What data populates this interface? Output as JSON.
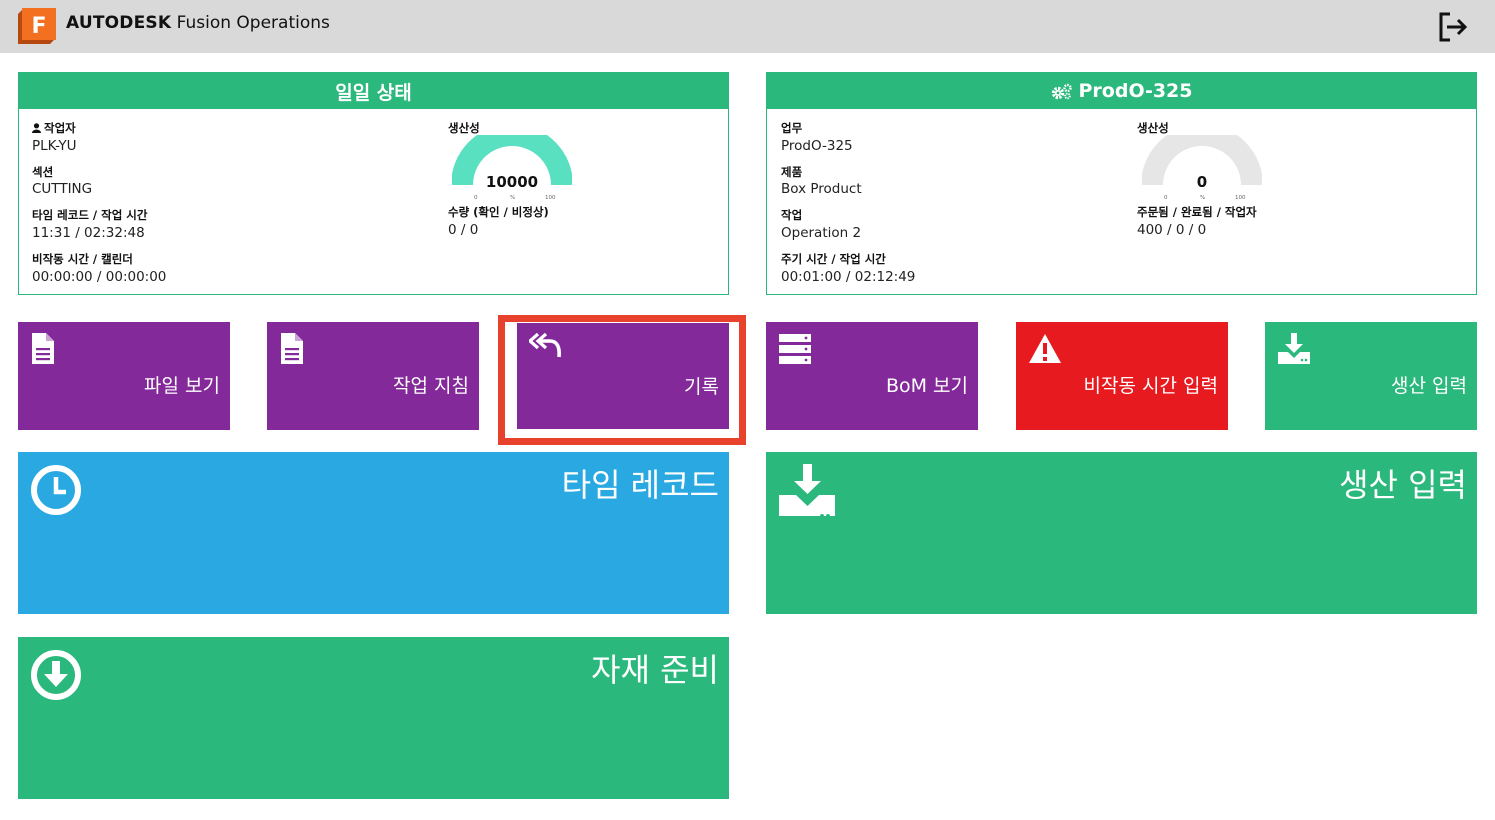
{
  "app": {
    "brand_bold": "AUTODESK",
    "brand_rest": "Fusion Operations",
    "logo_letter": "F"
  },
  "icons": {
    "logo": "fusion-logo-icon",
    "logout": "logout-icon"
  },
  "daily_status": {
    "title": "일일 상태",
    "operator_label": "작업자",
    "operator_value": "PLK-YU",
    "section_label": "섹션",
    "section_value": "CUTTING",
    "timerecord_label": "타임 레코드 / 작업 시간",
    "timerecord_value": "11:31 / 02:32:48",
    "downtime_label": "비작동 시간 / 캘린더",
    "downtime_value": "00:00:00 / 00:00:00",
    "productivity_label": "생산성",
    "gauge": {
      "value": "10000",
      "min": "0",
      "unit": "%",
      "max": "100",
      "fill": 1.0,
      "color": "#58e0c0"
    },
    "quantity_label": "수량 (확인 / 비정상)",
    "quantity_value": "0 / 0"
  },
  "order_panel": {
    "title": "ProdO-325",
    "task_label": "업무",
    "task_value": "ProdO-325",
    "product_label": "제품",
    "product_value": "Box Product",
    "operation_label": "작업",
    "operation_value": "Operation 2",
    "cycle_label": "주기 시간 / 작업 시간",
    "cycle_value": "00:01:00 / 02:12:49",
    "productivity_label": "생산성",
    "gauge": {
      "value": "0",
      "min": "0",
      "unit": "%",
      "max": "100",
      "fill": 0.0,
      "color": "#e6e6e6"
    },
    "ordered_label": "주문됨 / 완료됨 / 작업자",
    "ordered_value": "400 / 0 / 0"
  },
  "tiles": {
    "file_view": "파일 보기",
    "work_instructions": "작업 지침",
    "history": "기록",
    "bom_view": "BoM 보기",
    "downtime_entry": "비작동 시간 입력",
    "production_entry": "생산 입력"
  },
  "big_tiles": {
    "time_record": "타임 레코드",
    "production_entry": "생산 입력",
    "material_prep": "자재 준비"
  },
  "colors": {
    "green": "#2bb87c",
    "purple": "#84299a",
    "red": "#e71b1f",
    "blue": "#29a8e2",
    "highlight": "#e8422d",
    "topbar": "#d9d9d9"
  }
}
